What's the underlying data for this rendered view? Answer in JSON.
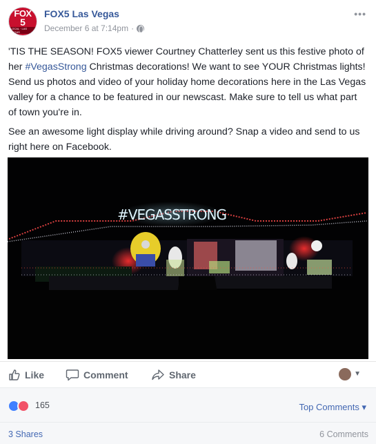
{
  "post": {
    "page_name": "FOX5 Las Vegas",
    "timestamp": "December 6 at 7:14pm",
    "separator": "·",
    "avatar": {
      "line1": "FOX",
      "line2": "5",
      "tag": "LOCAL · LAS VEGAS"
    },
    "paragraph1_before": "'TIS THE SEASON! FOX5 viewer Courtney Chatterley sent us this festive photo of her ",
    "hashtag": "#VegasStrong",
    "paragraph1_after": " Christmas decorations! We want to see YOUR Christmas lights! Send us photos and video of your holiday home decorations here in the Las Vegas valley for a chance to be featured in our newscast. Make sure to tell us what part of town you're in.",
    "paragraph2": "See an awesome light display while driving around? Snap a video and send to us right here on Facebook.",
    "photo_sign_text": "#VEGASSTRONG"
  },
  "actions": {
    "like": "Like",
    "comment": "Comment",
    "share": "Share"
  },
  "reactions": {
    "count": "165",
    "icons": [
      "like-reaction",
      "love-reaction"
    ],
    "sort_label": "Top Comments ▾"
  },
  "footer": {
    "shares": "3 Shares",
    "comments": "6 Comments"
  },
  "colors": {
    "link": "#365899",
    "meta": "#90949c",
    "action": "#606770",
    "like_blue": "#4080ff",
    "love_red": "#f25268"
  }
}
